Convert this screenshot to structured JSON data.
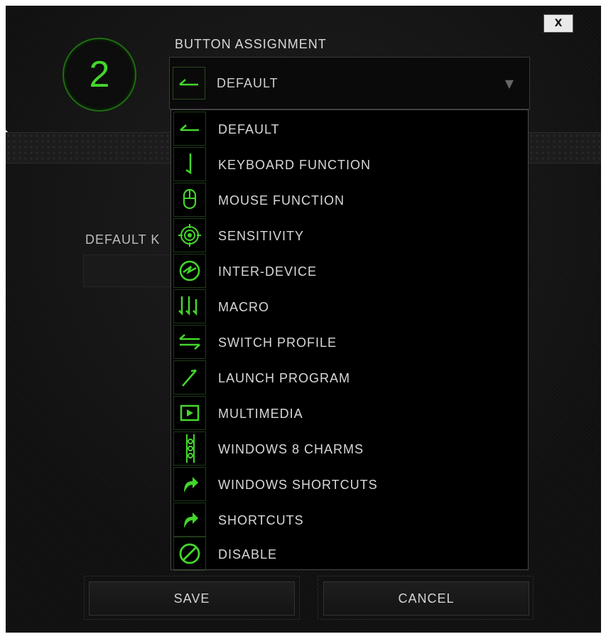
{
  "window": {
    "close_label": "X"
  },
  "button_number": "2",
  "title": "BUTTON ASSIGNMENT",
  "select": {
    "value": "DEFAULT",
    "icon": "default-arrow-icon",
    "caret": "▼"
  },
  "behind": {
    "label": "DEFAULT K"
  },
  "colors": {
    "accent": "#44d62c",
    "background": "#111111",
    "text": "#d8d8d8"
  },
  "options": [
    {
      "label": "DEFAULT",
      "icon": "default-arrow-icon"
    },
    {
      "label": "KEYBOARD FUNCTION",
      "icon": "keyboard-function-icon"
    },
    {
      "label": "MOUSE FUNCTION",
      "icon": "mouse-icon"
    },
    {
      "label": "SENSITIVITY",
      "icon": "crosshair-icon"
    },
    {
      "label": "INTER-DEVICE",
      "icon": "inter-device-icon"
    },
    {
      "label": "MACRO",
      "icon": "macro-icon"
    },
    {
      "label": "SWITCH PROFILE",
      "icon": "switch-arrows-icon"
    },
    {
      "label": "LAUNCH PROGRAM",
      "icon": "launch-icon"
    },
    {
      "label": "MULTIMEDIA",
      "icon": "play-icon"
    },
    {
      "label": "WINDOWS 8 CHARMS",
      "icon": "charms-icon"
    },
    {
      "label": "WINDOWS SHORTCUTS",
      "icon": "shortcut-arrow-icon"
    },
    {
      "label": "SHORTCUTS",
      "icon": "shortcut-arrow-icon"
    },
    {
      "label": "DISABLE",
      "icon": "disable-icon"
    }
  ],
  "buttons": {
    "save": "SAVE",
    "cancel": "CANCEL"
  }
}
